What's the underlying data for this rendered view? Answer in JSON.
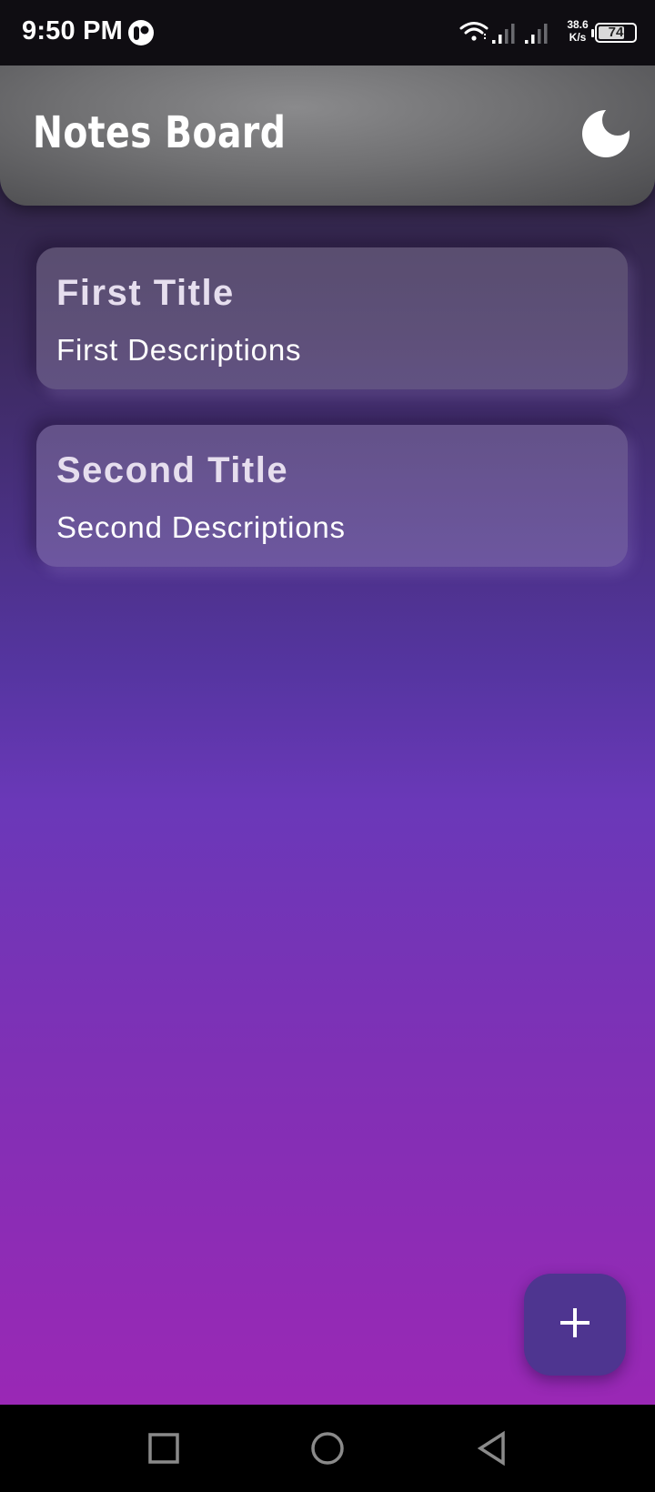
{
  "status_bar": {
    "time": "9:50 PM",
    "app_icon": "messaging-app-icon",
    "icons": [
      "wifi-icon",
      "signal-icon",
      "signal-icon"
    ],
    "net_speed_value": "38.6",
    "net_speed_unit": "K/s",
    "battery_level": "74"
  },
  "header": {
    "title": "Notes Board",
    "theme_toggle_icon": "moon-icon"
  },
  "notes": [
    {
      "title": "First Title",
      "description": "First Descriptions"
    },
    {
      "title": "Second Title",
      "description": "Second Descriptions"
    }
  ],
  "fab": {
    "icon": "plus-icon"
  },
  "nav_bar": {
    "buttons": [
      "recents-button",
      "home-button",
      "back-button"
    ]
  },
  "colors": {
    "fab_background": "#4e3590",
    "gradient_top": "#2a2238",
    "gradient_bottom": "#9a28b5"
  }
}
